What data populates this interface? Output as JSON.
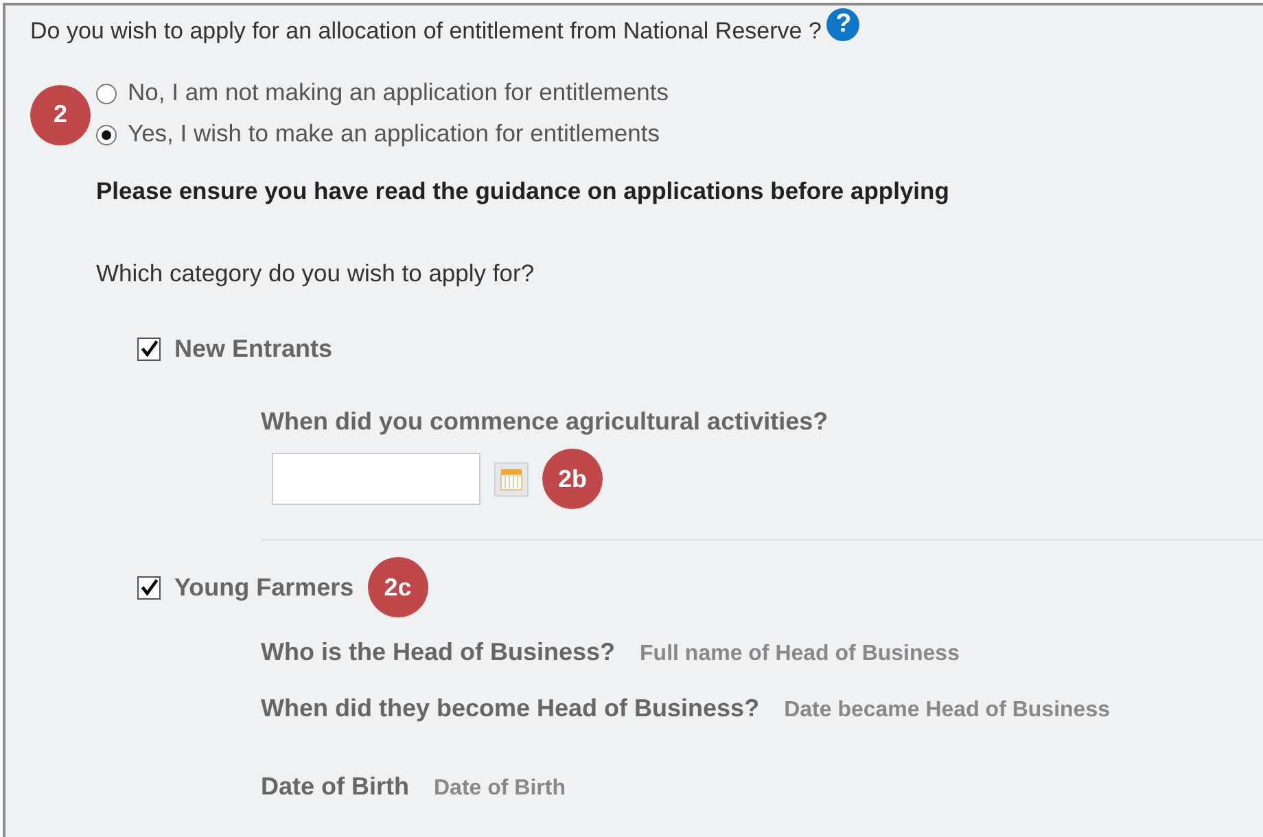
{
  "question": {
    "text": "Do you wish to apply for an allocation of entitlement from National Reserve ?",
    "help": "?"
  },
  "application": {
    "badge": "2",
    "options": [
      {
        "label": "No, I am not making an application for entitlements",
        "selected": false
      },
      {
        "label": "Yes, I wish to make an application for entitlements",
        "selected": true
      }
    ]
  },
  "guidance": "Please ensure you have read the guidance on applications before applying",
  "category_prompt": "Which category do you wish to apply for?",
  "categories": [
    {
      "label": "New Entrants",
      "checked": true,
      "kind": "date",
      "question": "When did you commence agricultural activities?",
      "date_badge": "2b"
    },
    {
      "label": "Young Farmers",
      "checked": true,
      "badge": "2c",
      "kind": "details",
      "fields": [
        {
          "label": "Who is the Head of Business?",
          "value": "Full name of Head of Business"
        },
        {
          "label": "When did they become Head of Business?",
          "value": "Date became Head of Business"
        },
        {
          "label": "Date of Birth",
          "value": "Date of Birth"
        }
      ]
    }
  ]
}
